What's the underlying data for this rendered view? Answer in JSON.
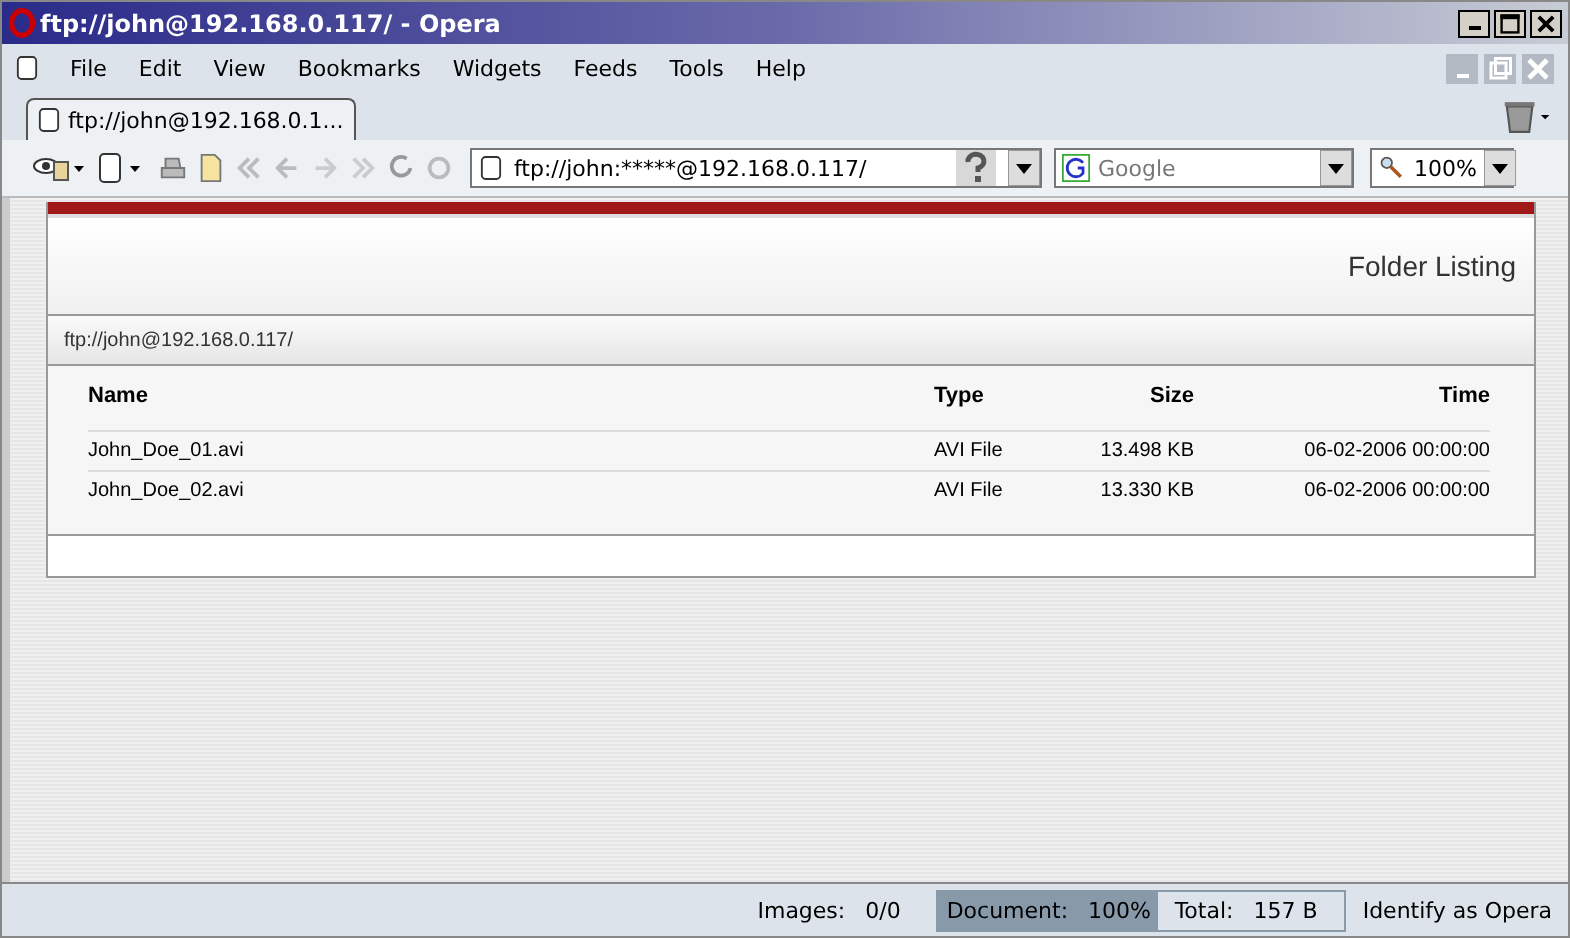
{
  "window": {
    "title": "ftp://john@192.168.0.117/ - Opera"
  },
  "menu": [
    "File",
    "Edit",
    "View",
    "Bookmarks",
    "Widgets",
    "Feeds",
    "Tools",
    "Help"
  ],
  "tabs": [
    {
      "label": "ftp://john@192.168.0.1...",
      "selected": true
    }
  ],
  "address": {
    "value": "ftp://john:*****@192.168.0.117/"
  },
  "search": {
    "placeholder": "Google"
  },
  "zoom": {
    "value": "100%"
  },
  "page": {
    "heading": "Folder Listing",
    "path": "ftp://john@192.168.0.117/",
    "table": {
      "columns": [
        "Name",
        "Type",
        "Size",
        "Time"
      ],
      "rows": [
        [
          "John_Doe_01.avi",
          "AVI File",
          "13.498 KB",
          "06-02-2006 00:00:00"
        ],
        [
          "John_Doe_02.avi",
          "AVI File",
          "13.330 KB",
          "06-02-2006 00:00:00"
        ]
      ]
    }
  },
  "status_bar": {
    "images_label": "Images:",
    "images": "0/0",
    "document_label": "Document:",
    "document": "100%",
    "document_progress": {
      "level": 1
    },
    "total_label": "Total:",
    "total": "157 B",
    "identify": "Identify as Opera"
  }
}
